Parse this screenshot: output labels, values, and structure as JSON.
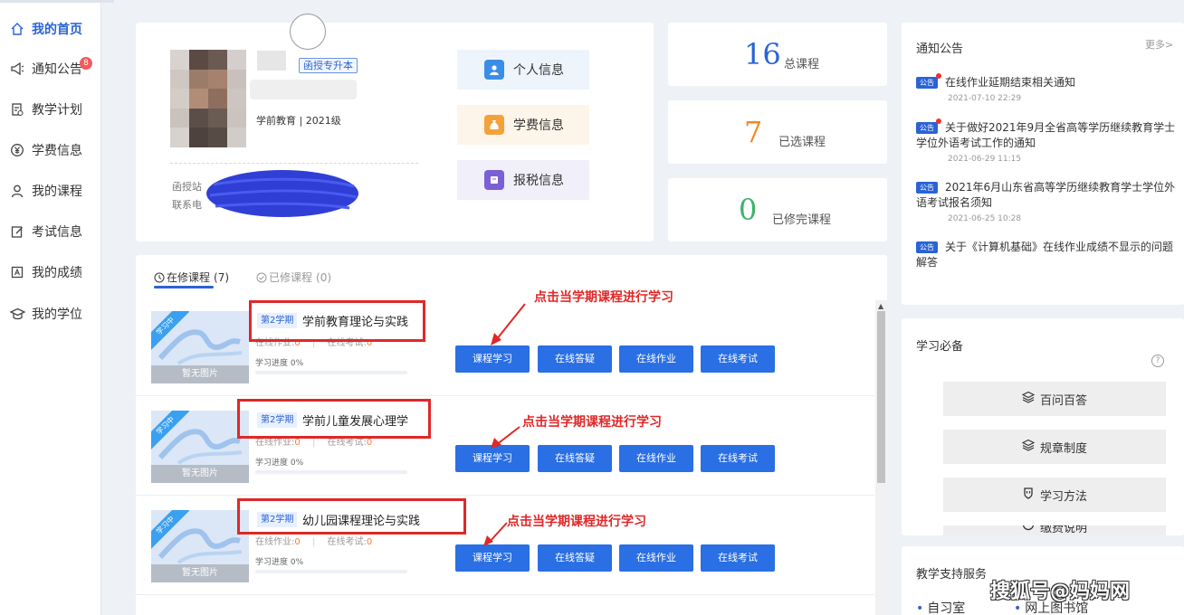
{
  "sidebar": {
    "items": [
      {
        "label": "我的首页",
        "icon": "home-icon"
      },
      {
        "label": "通知公告",
        "icon": "megaphone-icon",
        "badge": "8"
      },
      {
        "label": "教学计划",
        "icon": "document-icon"
      },
      {
        "label": "学费信息",
        "icon": "yen-icon"
      },
      {
        "label": "我的课程",
        "icon": "user-icon"
      },
      {
        "label": "考试信息",
        "icon": "edit-icon"
      },
      {
        "label": "我的成绩",
        "icon": "score-icon"
      },
      {
        "label": "我的学位",
        "icon": "graduation-cap-icon"
      }
    ]
  },
  "profile": {
    "program_tag": "函授专升本",
    "major": "学前教育 | 2021级",
    "station_label": "函授站",
    "contact_label": "联系电",
    "buttons": {
      "personal": "个人信息",
      "tuition": "学费信息",
      "tax": "报税信息"
    }
  },
  "stats": [
    {
      "value": "16",
      "label": "总课程",
      "color": "#2a63d4"
    },
    {
      "value": "7",
      "label": "已选课程",
      "color": "#f08a24"
    },
    {
      "value": "0",
      "label": "已修完课程",
      "color": "#3db36b"
    }
  ],
  "courses_tabs": {
    "current": "在修课程",
    "current_count": "(7)",
    "completed": "已修课程",
    "completed_count": "(0)"
  },
  "courses": [
    {
      "semester": "第2学期",
      "name": "学前教育理论与实践",
      "homework_label": "在线作业:",
      "homework_value": "0",
      "exam_label": "在线考试:",
      "exam_value": "0",
      "progress_label": "学习进度 0%",
      "progress": 0
    },
    {
      "semester": "第2学期",
      "name": "学前儿童发展心理学",
      "homework_label": "在线作业:",
      "homework_value": "0",
      "exam_label": "在线考试:",
      "exam_value": "0",
      "progress_label": "学习进度 0%",
      "progress": 0
    },
    {
      "semester": "第2学期",
      "name": "幼儿园课程理论与实践",
      "homework_label": "在线作业:",
      "homework_value": "0",
      "exam_label": "在线考试:",
      "exam_value": "0",
      "progress_label": "学习进度 0%",
      "progress": 0
    }
  ],
  "course_thumb": {
    "ribbon": "学习中",
    "no_image": "暂无图片"
  },
  "course_buttons": {
    "study": "课程学习",
    "qa": "在线答疑",
    "homework": "在线作业",
    "exam": "在线考试"
  },
  "hint_text": "点击当学期课程进行学习",
  "notices": {
    "title": "通知公告",
    "more": "更多>",
    "tag": "公告",
    "items": [
      {
        "title": "在线作业延期结束相关通知",
        "date": "2021-07-10 22:29"
      },
      {
        "title": "关于做好2021年9月全省高等学历继续教育学士学位外语考试工作的通知",
        "date": "2021-06-29 11:15"
      },
      {
        "title": "2021年6月山东省高等学历继续教育学士学位外语考试报名须知",
        "date": "2021-06-25 10:28"
      },
      {
        "title": "关于《计算机基础》在线作业成绩不显示的问题解答",
        "date": ""
      }
    ]
  },
  "study_essentials": {
    "title": "学习必备",
    "help": "?",
    "buttons": [
      "百问百答",
      "规章制度",
      "学习方法",
      "缴费说明"
    ]
  },
  "support": {
    "title": "教学支持服务",
    "links": [
      "自习室",
      "网上图书馆"
    ]
  },
  "watermark": "搜狐号@妈妈网"
}
